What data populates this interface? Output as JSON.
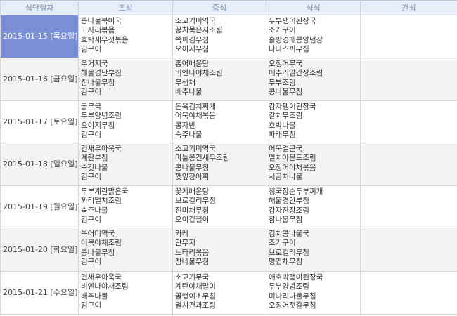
{
  "headers": {
    "date": "식단일자",
    "breakfast": "조식",
    "lunch": "중식",
    "dinner": "석식",
    "snack": "간식"
  },
  "rows": [
    {
      "date": "2015-01-15 [목요일]",
      "breakfast": [
        "콩나물북어국",
        "고사리볶음",
        "호박새우젓볶음",
        "김구이"
      ],
      "lunch": [
        "소고기미역국",
        "꽁치묵은지조림",
        "쪽파김무침",
        "오이지무침"
      ],
      "dinner": [
        "두부팽이된장국",
        "조기구이",
        "홀방경매콩양념장",
        "나나스끼무침"
      ],
      "snack": []
    },
    {
      "date": "2015-01-16 [금요일]",
      "breakfast": [
        "우거지국",
        "해물경단부침",
        "참나물무침",
        "김구이"
      ],
      "lunch": [
        "홍어매운탕",
        "비엔나야채조림",
        "무생채",
        "배추나물"
      ],
      "dinner": [
        "오징어무국",
        "메추리알간장조림",
        "두부조림",
        "콩나물무침"
      ],
      "snack": []
    },
    {
      "date": "2015-01-17 [토요일]",
      "breakfast": [
        "굴무국",
        "두부양념조림",
        "오이지무침",
        "김구이"
      ],
      "lunch": [
        "돈육김치찌개",
        "어묵야채볶음",
        "콩자반",
        "숙주나물"
      ],
      "dinner": [
        "감자팽이된장국",
        "갈치무조림",
        "호박나물",
        "파래무침"
      ],
      "snack": []
    },
    {
      "date": "2015-01-18 [일요일]",
      "breakfast": [
        "건새우아욱국",
        "계란부침",
        "숙갓나물",
        "김구이"
      ],
      "lunch": [
        "소고기미역국",
        "마늘쫑건새우조림",
        "콩나물무침",
        "깻잎장아찌"
      ],
      "dinner": [
        "어묵얼큰국",
        "멸치아몬드조림",
        "오징어야채볶음",
        "시금치나물"
      ],
      "snack": []
    },
    {
      "date": "2015-01-19 [월요일]",
      "breakfast": [
        "두부계란맑은국",
        "꽈리멸치조림",
        "숙주나물",
        "김구이"
      ],
      "lunch": [
        "꽃게매운탕",
        "브로컬리무침",
        "진미채무침",
        "오이겉절이"
      ],
      "dinner": [
        "청국장순두부찌개",
        "해물경단부침",
        "감자잔장조림",
        "참나물무침"
      ],
      "snack": []
    },
    {
      "date": "2015-01-20 [화요일]",
      "breakfast": [
        "북어미역국",
        "어묵야채조림",
        "콩나물무침",
        "김구이"
      ],
      "lunch": [
        "카레",
        "단무지",
        "느타리볶음",
        "참나물무침"
      ],
      "dinner": [
        "김치콩나물국",
        "조기구이",
        "브로컬리무침",
        "명엽채무침"
      ],
      "snack": []
    },
    {
      "date": "2015-01-21 [수요일]",
      "breakfast": [
        "건새우아욱국",
        "비엔나야채조림",
        "배추나물",
        "김구이"
      ],
      "lunch": [
        "소고기무국",
        "계란야채말이",
        "골뱅이초무침",
        "멸치견과조림"
      ],
      "dinner": [
        "애호박팽이된장국",
        "두부양념조림",
        "미나리나물무침",
        "오징어젓갈무침"
      ],
      "snack": []
    }
  ],
  "selected_row": 0
}
